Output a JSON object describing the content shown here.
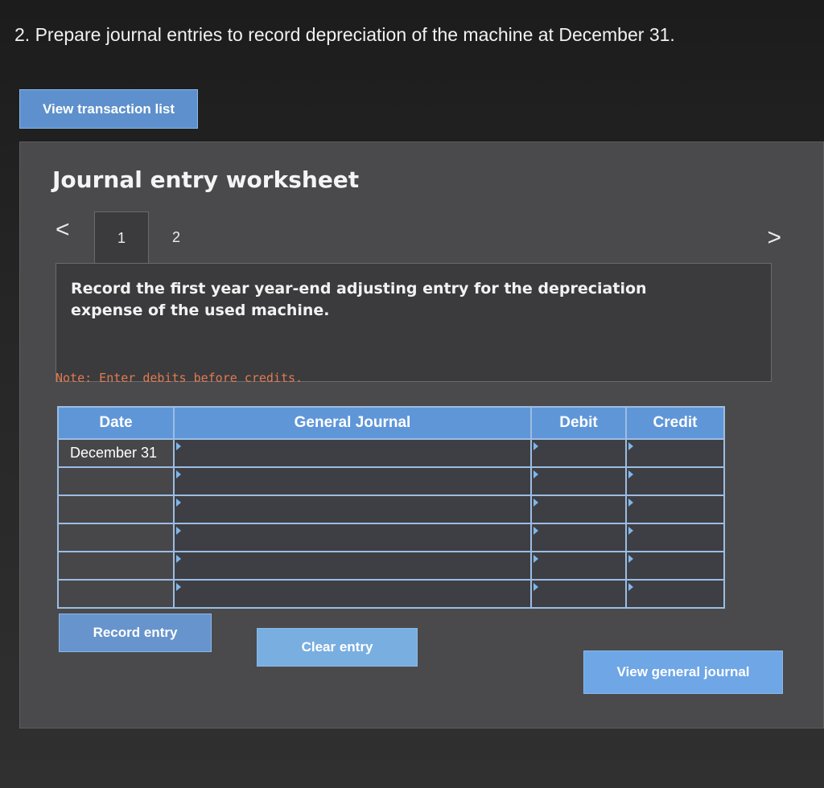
{
  "question": "2. Prepare journal entries to record depreciation of the machine at December 31.",
  "buttons": {
    "view_transaction_list": "View transaction list",
    "record_entry": "Record entry",
    "clear_entry": "Clear entry",
    "view_general_journal": "View general journal"
  },
  "worksheet": {
    "title": "Journal entry worksheet",
    "prev_icon": "<",
    "next_icon": ">",
    "tabs": [
      "1",
      "2"
    ],
    "instruction": "Record the first year year-end adjusting entry for the depreciation expense of the used machine.",
    "note": "Note: Enter debits before credits."
  },
  "table": {
    "headers": [
      "Date",
      "General Journal",
      "Debit",
      "Credit"
    ],
    "rows": [
      {
        "date": "December 31",
        "account": "",
        "debit": "",
        "credit": ""
      },
      {
        "date": "",
        "account": "",
        "debit": "",
        "credit": ""
      },
      {
        "date": "",
        "account": "",
        "debit": "",
        "credit": ""
      },
      {
        "date": "",
        "account": "",
        "debit": "",
        "credit": ""
      },
      {
        "date": "",
        "account": "",
        "debit": "",
        "credit": ""
      },
      {
        "date": "",
        "account": "",
        "debit": "",
        "credit": ""
      }
    ]
  },
  "colors": {
    "button_blue": "#6b9ed6",
    "header_blue": "#5f96d8",
    "note_orange": "#e07b52",
    "panel_gray": "#4a4a4c"
  }
}
